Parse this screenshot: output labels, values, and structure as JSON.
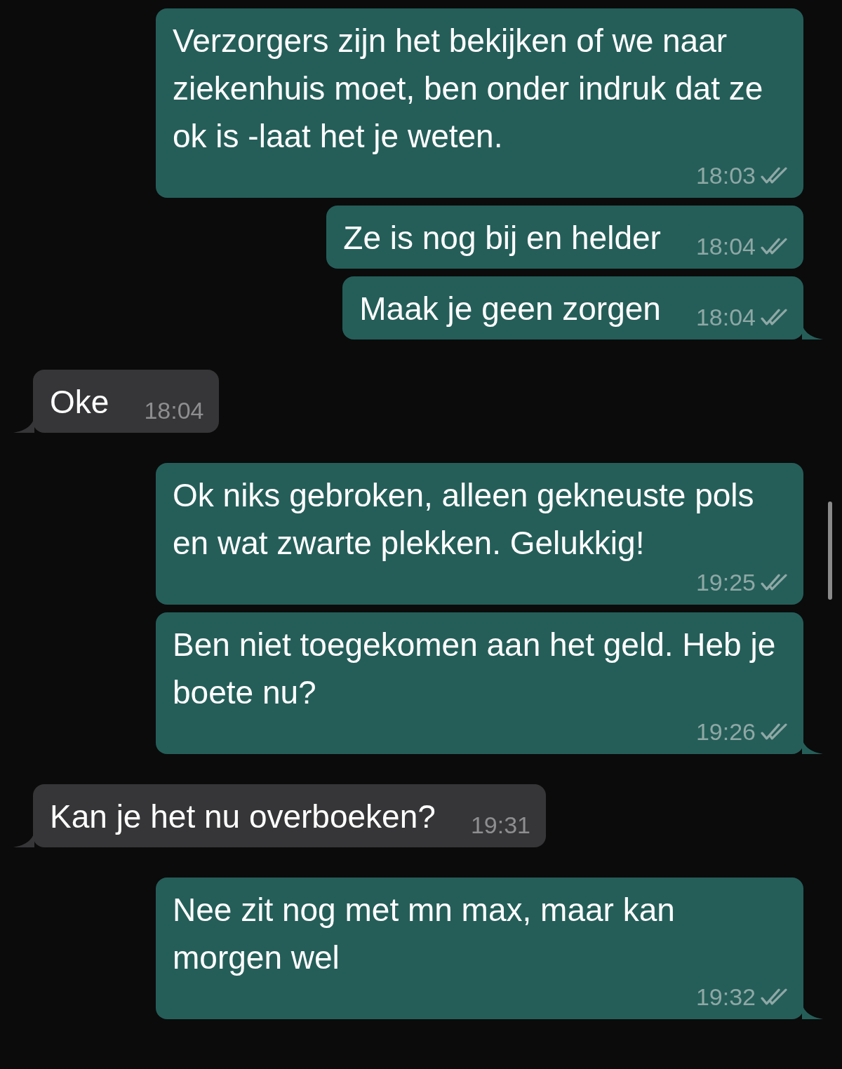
{
  "messages": [
    {
      "kind": "outgoing",
      "text": "Verzorgers zijn het bekijken of we naar ziekenhuis moet, ben onder indruk dat ze ok is -laat het je weten.",
      "time": "18:03",
      "read": false,
      "tail": false
    },
    {
      "kind": "outgoing",
      "text": "Ze is nog bij en helder",
      "time": "18:04",
      "read": false,
      "tail": false
    },
    {
      "kind": "outgoing",
      "text": "Maak je geen zorgen",
      "time": "18:04",
      "read": false,
      "tail": true
    },
    {
      "kind": "incoming",
      "text": "Oke",
      "time": "18:04",
      "tail": true
    },
    {
      "kind": "outgoing",
      "text": "Ok niks gebroken, alleen gekneuste pols en wat zwarte plekken. Gelukkig!",
      "time": "19:25",
      "read": false,
      "tail": false
    },
    {
      "kind": "outgoing",
      "text": "Ben niet toegekomen aan het geld. Heb je boete nu?",
      "time": "19:26",
      "read": false,
      "tail": true
    },
    {
      "kind": "incoming",
      "text": "Kan je het nu overboeken?",
      "time": "19:31",
      "tail": true
    },
    {
      "kind": "outgoing",
      "text": "Nee zit nog met mn max, maar kan morgen wel",
      "time": "19:32",
      "read": false,
      "tail": true
    }
  ]
}
